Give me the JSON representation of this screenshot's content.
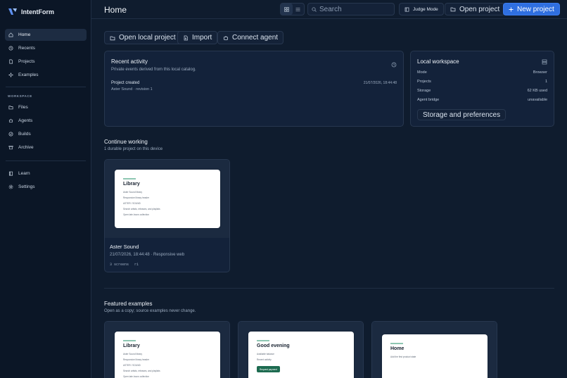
{
  "brand": {
    "name": "IntentForm"
  },
  "sidebar": {
    "items": [
      {
        "label": "Home",
        "icon": "home-icon"
      },
      {
        "label": "Recents",
        "icon": "clock-icon"
      },
      {
        "label": "Projects",
        "icon": "file-icon"
      },
      {
        "label": "Examples",
        "icon": "sparkle-icon"
      }
    ],
    "workspace_label": "WORKSPACE",
    "workspace_items": [
      {
        "label": "Files",
        "icon": "folder-icon"
      },
      {
        "label": "Agents",
        "icon": "agent-icon"
      },
      {
        "label": "Builds",
        "icon": "check-icon"
      },
      {
        "label": "Archive",
        "icon": "archive-icon"
      }
    ],
    "footer_items": [
      {
        "label": "Learn",
        "icon": "book-icon"
      },
      {
        "label": "Settings",
        "icon": "gear-icon"
      }
    ]
  },
  "header": {
    "title": "Home",
    "search_placeholder": "Search",
    "judge_mode_label": "Judge Mode",
    "open_project_label": "Open project",
    "new_project_label": "New project"
  },
  "actions": {
    "open_local_label": "Open local project",
    "import_label": "Import",
    "connect_agent_label": "Connect agent"
  },
  "recent_activity": {
    "title": "Recent activity",
    "subtitle": "Private events derived from this local catalog.",
    "events": [
      {
        "title": "Project created",
        "detail": "Aster Sound · revision 1",
        "timestamp": "21/07/2026, 18:44:48"
      }
    ]
  },
  "local_workspace": {
    "title": "Local workspace",
    "rows": [
      {
        "key": "Mode",
        "value": "Browser"
      },
      {
        "key": "Projects",
        "value": "1"
      },
      {
        "key": "Storage",
        "value": "62 KB used"
      },
      {
        "key": "Agent bridge",
        "value": "unavailable"
      }
    ],
    "preferences_label": "Storage and preferences"
  },
  "continue_working": {
    "title": "Continue working",
    "subtitle": "1 durable project on this device",
    "project": {
      "name": "Aster Sound",
      "meta": "21/07/2026, 18:44:48 · Responsive web",
      "screens": "3 screens",
      "revision": "r1",
      "preview": {
        "heading": "Library",
        "lines": [
          "Aster Sound library",
          "Responsive library header",
          "ASTER / SOUND",
          "Search artists, releases, and playlists",
          "Open late-hours collection"
        ]
      }
    }
  },
  "featured": {
    "title": "Featured examples",
    "subtitle": "Open as a copy; source examples never change.",
    "examples": [
      {
        "heading": "Library",
        "lines": [
          "Aster Sound library",
          "Responsive library header",
          "ASTER / SOUND",
          "Search artists, releases, and playlists",
          "Open late-hours collection"
        ]
      },
      {
        "heading": "Good evening",
        "lines": [
          "Available balance",
          "Recent activity"
        ],
        "button": "Request payment"
      },
      {
        "heading": "Home",
        "lines": [
          "Add the first product state"
        ]
      }
    ]
  }
}
